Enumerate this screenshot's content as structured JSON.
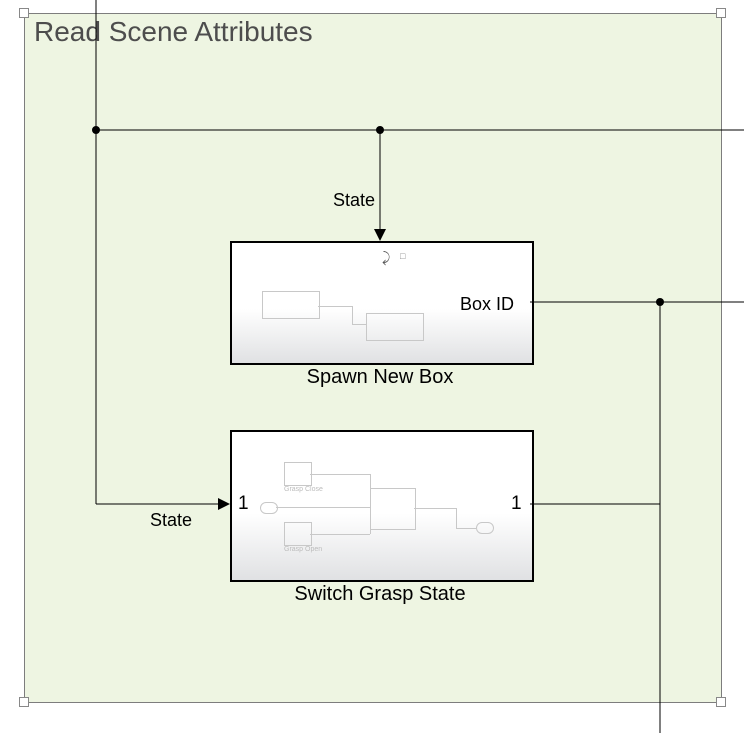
{
  "group": {
    "title": "Read Scene Attributes"
  },
  "blocks": {
    "spawn": {
      "name": "Spawn New Box",
      "output_label": "Box ID",
      "trigger_signal_label": "State"
    },
    "switch": {
      "name": "Switch Grasp State",
      "input_port_number": "1",
      "output_port_number": "1",
      "input_signal_label": "State",
      "internal_labels": {
        "top": "Grasp Close",
        "bottom": "Grasp Open"
      }
    }
  },
  "colors": {
    "group_bg": "#eef5e2"
  }
}
